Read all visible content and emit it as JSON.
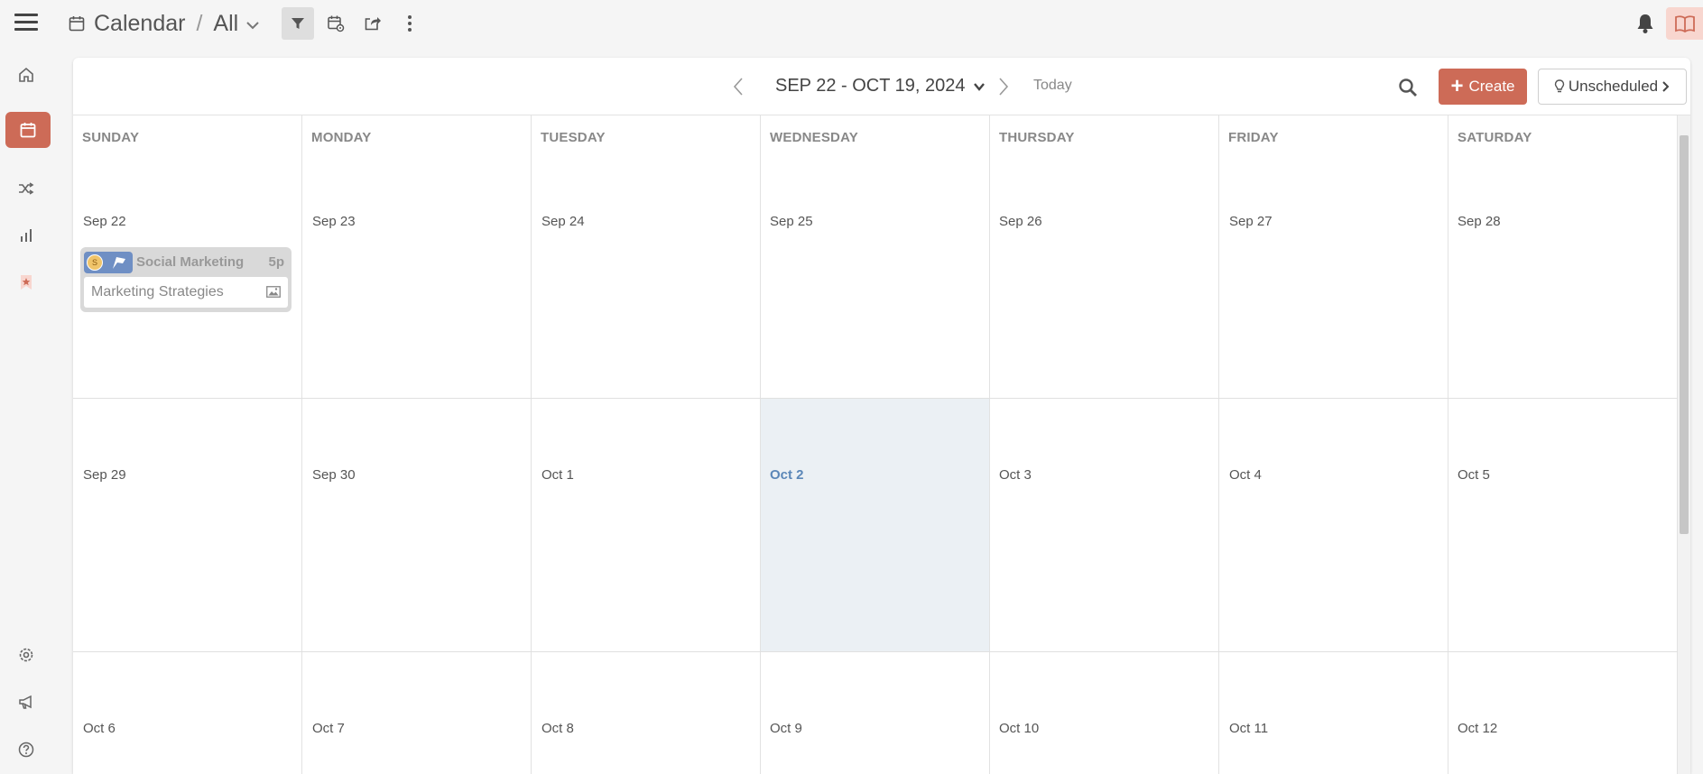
{
  "header": {
    "title": "Calendar",
    "separator": "/",
    "view": "All"
  },
  "calendar": {
    "range": "SEP 22 - OCT 19, 2024",
    "today_label": "Today",
    "create_label": "Create",
    "unscheduled_label": "Unscheduled",
    "days": [
      "SUNDAY",
      "MONDAY",
      "TUESDAY",
      "WEDNESDAY",
      "THURSDAY",
      "FRIDAY",
      "SATURDAY"
    ],
    "weeks": [
      [
        "Sep 22",
        "Sep 23",
        "Sep 24",
        "Sep 25",
        "Sep 26",
        "Sep 27",
        "Sep 28"
      ],
      [
        "Sep 29",
        "Sep 30",
        "Oct 1",
        "Oct 2",
        "Oct 3",
        "Oct 4",
        "Oct 5"
      ],
      [
        "Oct 6",
        "Oct 7",
        "Oct 8",
        "Oct 9",
        "Oct 10",
        "Oct 11",
        "Oct 12"
      ]
    ],
    "event": {
      "avatar": "S",
      "title": "Social Marketing",
      "time": "5p",
      "subtitle": "Marketing Strategies"
    }
  },
  "colors": {
    "accent": "#cd6b57",
    "today_bg": "#ebf0f4",
    "today_text": "#5b87b8",
    "event_tag": "#6f8fc4"
  },
  "sidebar": {
    "icons": [
      "home-icon",
      "calendar-icon",
      "shuffle-icon",
      "bar-chart-icon",
      "star-bookmark-icon",
      "gear-icon",
      "megaphone-icon",
      "help-icon"
    ]
  }
}
